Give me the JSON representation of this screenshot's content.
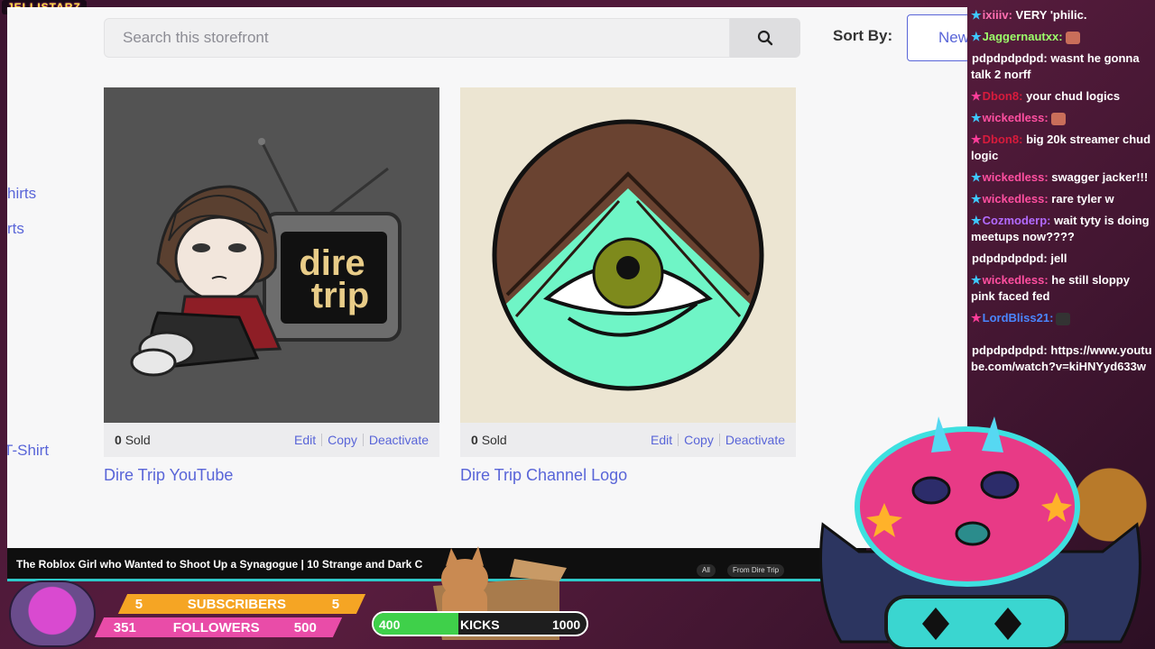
{
  "overlay": {
    "streamer_tag": "JELLISTARZ"
  },
  "storefront": {
    "search_placeholder": "Search this storefront",
    "sort_label": "Sort By:",
    "sort_value": "New",
    "side_links": [
      "hirts",
      "rts",
      "T-Shirt"
    ],
    "products": [
      {
        "sold_count": "0",
        "sold_label": "Sold",
        "edit": "Edit",
        "copy": "Copy",
        "deactivate": "Deactivate",
        "title": "Dire Trip YouTube",
        "tv_line1": "dire",
        "tv_line2": "trip"
      },
      {
        "sold_count": "0",
        "sold_label": "Sold",
        "edit": "Edit",
        "copy": "Copy",
        "deactivate": "Deactivate",
        "title": "Dire Trip Channel Logo"
      }
    ]
  },
  "chat": {
    "messages": [
      {
        "user": "ixiiiv:",
        "text": "VERY 'philic.",
        "color": "#ff6fb0"
      },
      {
        "user": "Jaggernautxx:",
        "text": "",
        "color": "#9cff6a"
      },
      {
        "user": "pdpdpdpdpd:",
        "text": "wasnt he gonna talk 2 norff",
        "color": "#ffffff"
      },
      {
        "user": "Dbon8:",
        "text": "your chud logics",
        "color": "#d81b3c"
      },
      {
        "user": "wickedless:",
        "text": "",
        "color": "#ff4fa0"
      },
      {
        "user": "Dbon8:",
        "text": "big 20k streamer chud logic",
        "color": "#d81b3c"
      },
      {
        "user": "wickedless:",
        "text": "swagger jacker!!!",
        "color": "#ff4fa0"
      },
      {
        "user": "wickedless:",
        "text": "rare tyler w",
        "color": "#ff4fa0"
      },
      {
        "user": "Cozmoderp:",
        "text": "wait tyty is doing meetups now????",
        "color": "#b36bff"
      },
      {
        "user": "pdpdpdpdpd:",
        "text": "jell",
        "color": "#ffffff"
      },
      {
        "user": "wickedless:",
        "text": "he still sloppy pink faced fed",
        "color": "#ff4fa0"
      },
      {
        "user": "LordBliss21:",
        "text": "",
        "color": "#4a86ff"
      },
      {
        "user": "pdpdpdpdpd:",
        "text": "https://www.youtube.com/watch?v=kiHNYyd633w",
        "color": "#ffffff"
      }
    ]
  },
  "youtube": {
    "video_title": "The Roblox Girl who Wanted to Shoot Up a Synagogue | 10 Strange and Dark C",
    "chips": [
      "All",
      "From Dire Trip"
    ]
  },
  "stats": {
    "subscribers": {
      "label": "SUBSCRIBERS",
      "current": "5",
      "goal": "5"
    },
    "followers": {
      "label": "FOLLOWERS",
      "current": "351",
      "goal": "500"
    },
    "kicks": {
      "label": "KICKS",
      "current": "400",
      "goal": "1000",
      "progress": 0.4
    }
  },
  "colors": {
    "accent": "#5965d8",
    "kick_green": "#3fd04a",
    "sub_orange": "#f5a524",
    "follow_pink": "#e94ca8"
  }
}
